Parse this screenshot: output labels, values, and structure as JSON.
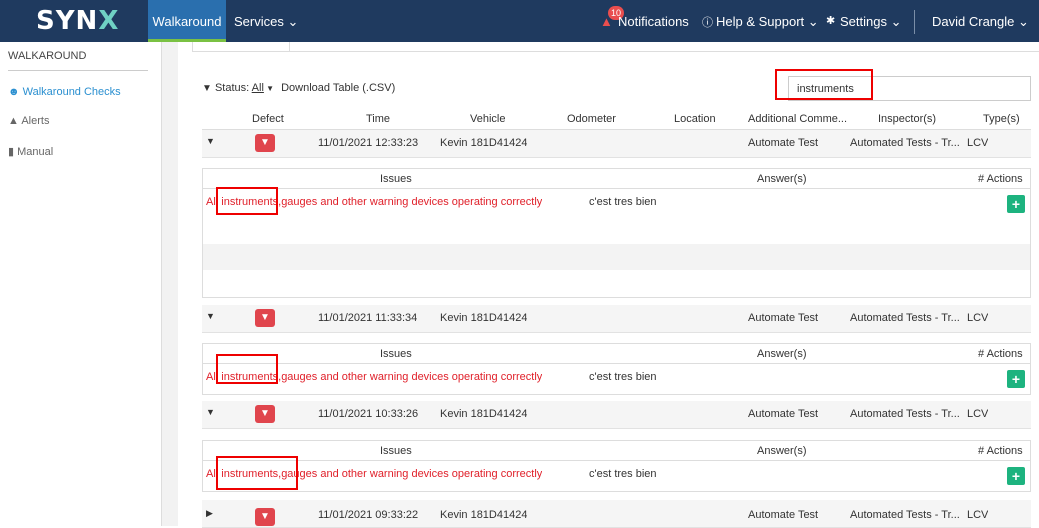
{
  "header": {
    "logo": "SYN",
    "logo_x": "X",
    "nav_active": "Walkaround",
    "services": "Services ⌄",
    "notifications": "Notifications",
    "notif_count": "10",
    "help": "Help & Support ⌄",
    "settings": "Settings ⌄",
    "user": "David Crangle ⌄"
  },
  "sidebar": {
    "title": "WALKAROUND",
    "items": [
      {
        "label": "Walkaround Checks",
        "icon": "user-circle-icon"
      },
      {
        "label": "Alerts",
        "icon": "warning-icon"
      },
      {
        "label": "Manual",
        "icon": "book-icon"
      }
    ]
  },
  "toolbar": {
    "status_label": "Status:",
    "status_value": "All",
    "download": "Download Table (.CSV)"
  },
  "search": {
    "value": "instruments"
  },
  "table": {
    "columns": [
      "Defect",
      "Time",
      "Vehicle",
      "Odometer",
      "Location",
      "Additional Comme...",
      "Inspector(s)",
      "Type(s)"
    ],
    "sub_columns": [
      "Issues",
      "Answer(s)",
      "# Actions"
    ],
    "rows": [
      {
        "time": "11/01/2021 12:33:23",
        "vehicle": "Kevin 181D41424",
        "comment": "Automate Test",
        "inspector": "Automated Tests - Tr...",
        "type": "LCV"
      },
      {
        "time": "11/01/2021 11:33:34",
        "vehicle": "Kevin 181D41424",
        "comment": "Automate Test",
        "inspector": "Automated Tests - Tr...",
        "type": "LCV"
      },
      {
        "time": "11/01/2021 10:33:26",
        "vehicle": "Kevin 181D41424",
        "comment": "Automate Test",
        "inspector": "Automated Tests - Tr...",
        "type": "LCV"
      },
      {
        "time": "11/01/2021 09:33:22",
        "vehicle": "Kevin 181D41424",
        "comment": "Automate Test",
        "inspector": "Automated Tests - Tr...",
        "type": "LCV"
      }
    ],
    "issue_text": "All instruments,gauges and other warning devices operating correctly",
    "answer_text": "c'est tres bien"
  },
  "colors": {
    "topbar": "#1f3a5f",
    "accent": "#2a6fae",
    "defect": "#e0454d",
    "add": "#1db37f",
    "issue": "#e0202a"
  }
}
